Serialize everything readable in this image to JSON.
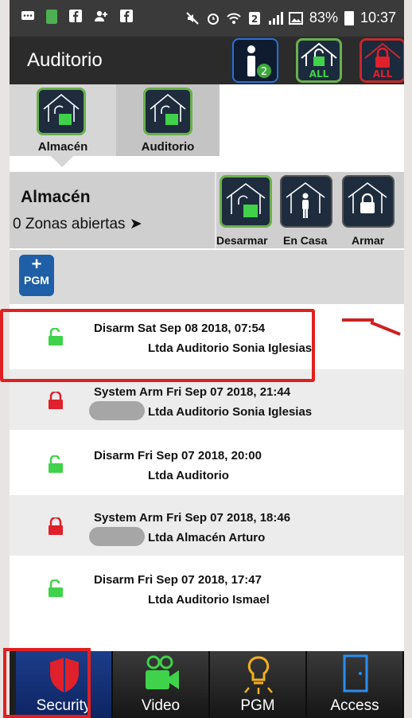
{
  "status_bar": {
    "battery": "83%",
    "time": "10:37"
  },
  "app_bar": {
    "title": "Auditorio",
    "info_badge": "2",
    "home_all_label": "ALL",
    "lock_all_label": "ALL"
  },
  "partitions": [
    {
      "label": "Almacén"
    },
    {
      "label": "Auditorio"
    }
  ],
  "summary": {
    "partition_name": "Almacén",
    "open_zones": "0 Zonas abiertas",
    "actions": [
      "Desarmar",
      "En Casa",
      "Armar"
    ]
  },
  "pgm_button": {
    "label": "PGM",
    "plus": "+"
  },
  "history": [
    {
      "line1": "Disarm Sat Sep 08 2018, 07:54",
      "line2": "Ltda Auditorio Sonia Iglesias",
      "status": "unlocked"
    },
    {
      "line1": "System Arm Fri Sep 07 2018, 21:44",
      "line2": "Ltda Auditorio Sonia Iglesias",
      "status": "locked"
    },
    {
      "line1": "Disarm Fri Sep 07 2018, 20:00",
      "line2": "Ltda Auditorio",
      "status": "unlocked"
    },
    {
      "line1": "System Arm Fri Sep 07 2018, 18:46",
      "line2": "Ltda Almacén Arturo",
      "status": "locked"
    },
    {
      "line1": "Disarm Fri Sep 07 2018, 17:47",
      "line2": "Ltda Auditorio Ismael",
      "status": "unlocked"
    }
  ],
  "bottom_nav": [
    {
      "label": "Security"
    },
    {
      "label": "Video"
    },
    {
      "label": "PGM"
    },
    {
      "label": "Access"
    }
  ],
  "colors": {
    "unlocked": "#3fd24a",
    "locked": "#e0202a",
    "highlight": "#e02020",
    "active_nav": "#1c3d8a"
  }
}
